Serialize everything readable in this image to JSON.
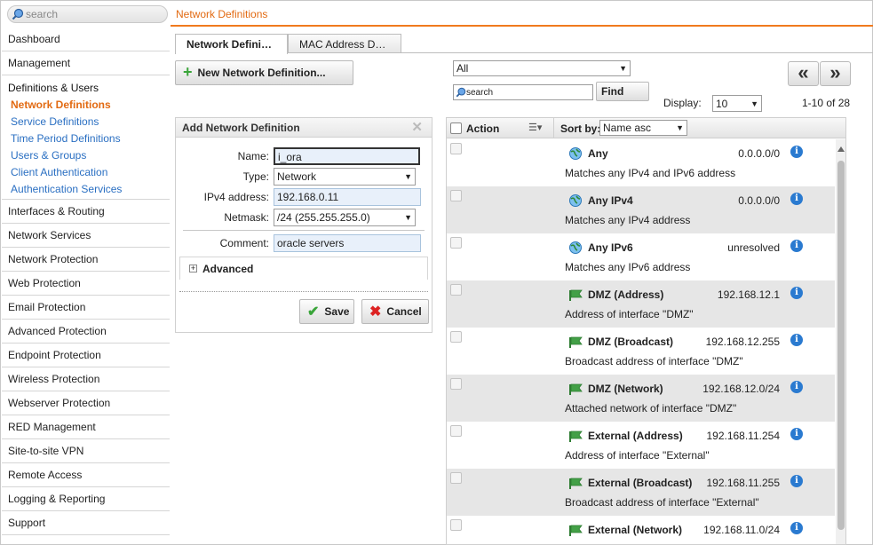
{
  "search": {
    "placeholder": "search"
  },
  "page_title": "Network Definitions",
  "sidebar": {
    "items_before": [
      "Dashboard",
      "Management"
    ],
    "group": {
      "label": "Definitions & Users",
      "items": [
        {
          "label": "Network Definitions",
          "active": true
        },
        {
          "label": "Service Definitions"
        },
        {
          "label": "Time Period Definitions"
        },
        {
          "label": "Users & Groups"
        },
        {
          "label": "Client Authentication"
        },
        {
          "label": "Authentication Services"
        }
      ]
    },
    "items_after": [
      "Interfaces & Routing",
      "Network Services",
      "Network Protection",
      "Web Protection",
      "Email Protection",
      "Advanced Protection",
      "Endpoint Protection",
      "Wireless Protection",
      "Webserver Protection",
      "RED Management",
      "Site-to-site VPN",
      "Remote Access",
      "Logging & Reporting",
      "Support"
    ]
  },
  "tabs": [
    {
      "label": "Network Defini…",
      "active": true
    },
    {
      "label": "MAC Address D…",
      "active": false
    }
  ],
  "toolbar": {
    "new_label": "New Network Definition..."
  },
  "add_form": {
    "title": "Add Network Definition",
    "name_label": "Name:",
    "name_value": "i_ora",
    "type_label": "Type:",
    "type_value": "Network",
    "ipv4_label": "IPv4 address:",
    "ipv4_value": "192.168.0.11",
    "netmask_label": "Netmask:",
    "netmask_value": "/24 (255.255.255.0)",
    "comment_label": "Comment:",
    "comment_value": "oracle servers",
    "advanced_label": "Advanced",
    "save_label": "Save",
    "cancel_label": "Cancel"
  },
  "list_controls": {
    "filter_value": "All",
    "search_placeholder": "search",
    "find_label": "Find",
    "display_label": "Display:",
    "display_value": "10",
    "count": "1-10 of 28",
    "prev_label": "«",
    "next_label": "»"
  },
  "list": {
    "action_header": "Action",
    "sort_label": "Sort by:",
    "sort_value": "Name asc",
    "rows": [
      {
        "name": "Any",
        "address": "0.0.0.0/0",
        "desc": "Matches any IPv4 and IPv6 address",
        "icon": "globe-icon"
      },
      {
        "name": "Any IPv4",
        "address": "0.0.0.0/0",
        "desc": "Matches any IPv4 address",
        "icon": "globe-icon"
      },
      {
        "name": "Any IPv6",
        "address": "unresolved",
        "desc": "Matches any IPv6 address",
        "icon": "globe-icon"
      },
      {
        "name": "DMZ (Address)",
        "address": "192.168.12.1",
        "desc": "Address of interface \"DMZ\"",
        "icon": "interface-icon"
      },
      {
        "name": "DMZ (Broadcast)",
        "address": "192.168.12.255",
        "desc": "Broadcast address of interface \"DMZ\"",
        "icon": "interface-icon"
      },
      {
        "name": "DMZ (Network)",
        "address": "192.168.12.0/24",
        "desc": "Attached network of interface \"DMZ\"",
        "icon": "interface-icon"
      },
      {
        "name": "External (Address)",
        "address": "192.168.11.254",
        "desc": "Address of interface \"External\"",
        "icon": "interface-icon"
      },
      {
        "name": "External (Broadcast)",
        "address": "192.168.11.255",
        "desc": "Broadcast address of interface \"External\"",
        "icon": "interface-icon"
      },
      {
        "name": "External (Network)",
        "address": "192.168.11.0/24",
        "desc": "",
        "icon": "interface-icon"
      }
    ]
  },
  "colors": {
    "accent": "#e26a12",
    "link": "#2a6fc2",
    "info": "#2a7ad0",
    "ok": "#3aa53a",
    "cancel": "#dd2222"
  }
}
